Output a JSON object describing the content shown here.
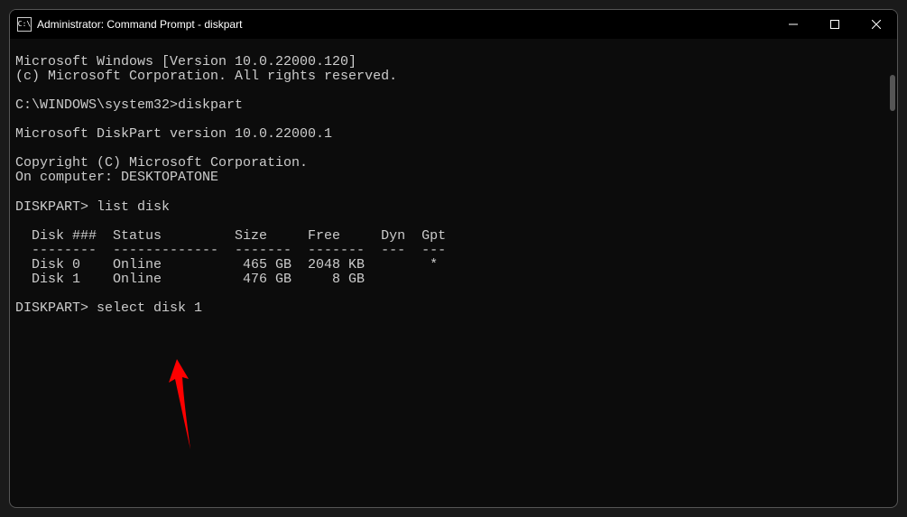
{
  "window": {
    "title": "Administrator: Command Prompt - diskpart",
    "icon_label": "C:\\"
  },
  "terminal": {
    "lines": [
      "Microsoft Windows [Version 10.0.22000.120]",
      "(c) Microsoft Corporation. All rights reserved.",
      "",
      "C:\\WINDOWS\\system32>diskpart",
      "",
      "Microsoft DiskPart version 10.0.22000.1",
      "",
      "Copyright (C) Microsoft Corporation.",
      "On computer: DESKTOPATONE",
      "",
      "DISKPART> list disk",
      "",
      "  Disk ###  Status         Size     Free     Dyn  Gpt",
      "  --------  -------------  -------  -------  ---  ---",
      "  Disk 0    Online          465 GB  2048 KB        *",
      "  Disk 1    Online          476 GB     8 GB",
      "",
      "DISKPART> select disk 1"
    ]
  }
}
